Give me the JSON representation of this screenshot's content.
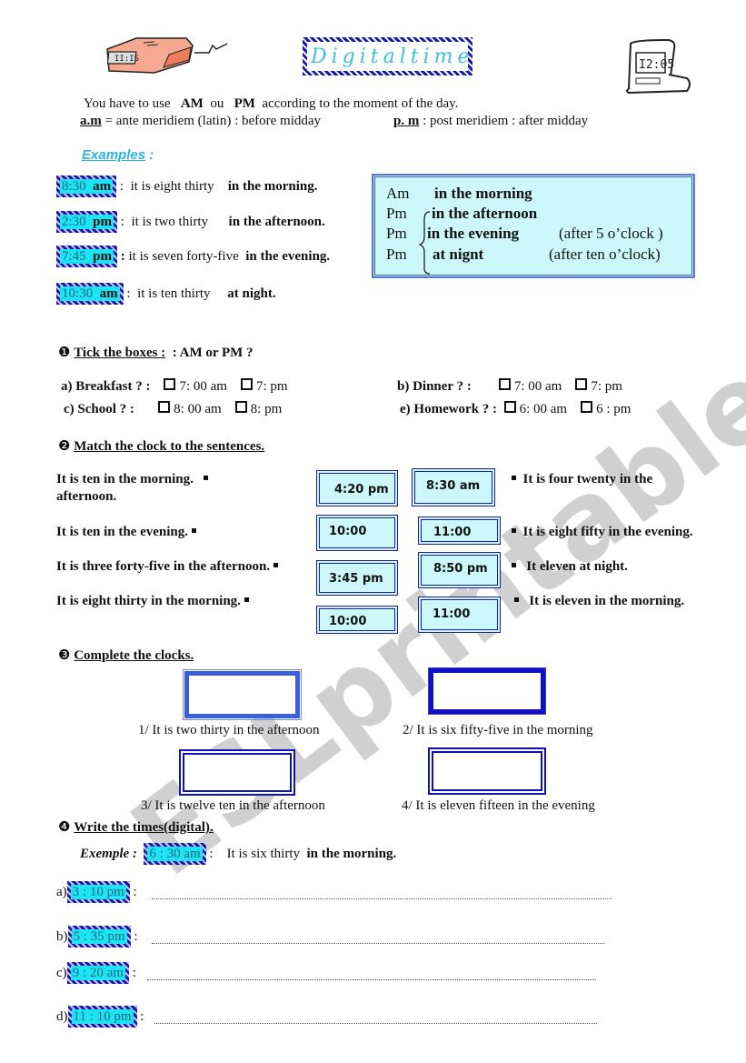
{
  "header": {
    "title": [
      "Digital",
      "time"
    ],
    "intro_line1": {
      "pre": "You have to use",
      "am": "AM",
      "ou": "ou",
      "pm": "PM",
      "post": "according to the moment of the day."
    },
    "intro_line2": {
      "am_label": "a.m",
      "am_def": "= ante meridiem (latin)  : before midday",
      "pm_label": "p. m",
      "pm_def": ":  post  meridiem : after midday"
    },
    "left_illustration": "alarm-clock-icon",
    "right_illustration": "digital-desk-clock-icon"
  },
  "examples": {
    "heading": "Examples",
    "colon": ":",
    "items": [
      {
        "time": "8:30",
        "ampm": "am",
        "sep": ":",
        "text": "it is eight thirty",
        "bold": "in the morning."
      },
      {
        "time": "2:30",
        "ampm": "pm",
        "sep": ":",
        "text": "it is two thirty",
        "bold": "in the afternoon."
      },
      {
        "time": "7:45",
        "ampm": "pm",
        "sep": ":",
        "text": "it is seven forty-five",
        "bold": "in the evening."
      },
      {
        "time": "10:30",
        "ampm": "am",
        "sep": ":",
        "text": "it is ten thirty",
        "bold": "at  night."
      }
    ],
    "legend": [
      {
        "key": "Am",
        "value": "in the morning",
        "note": ""
      },
      {
        "key": "Pm",
        "value": "in the afternoon",
        "note": ""
      },
      {
        "key": "Pm",
        "value": "in the  evening",
        "note": "(after 5 o’clock )"
      },
      {
        "key": "Pm",
        "value": "at nignt",
        "note": "(after ten o’clock)"
      }
    ]
  },
  "section1": {
    "bullet": "❶",
    "title": "Tick the boxes :",
    "question": ":   AM  or  PM ?",
    "items": [
      {
        "label": "a)   Breakfast ?   :",
        "opt1": "7: 00  am",
        "opt2": "7: pm"
      },
      {
        "label": "b) Dinner ?   :",
        "opt1": "7: 00  am",
        "opt2": "7: pm"
      },
      {
        "label": "c)  School ?        :",
        "opt1": "8: 00  am",
        "opt2": "8: pm"
      },
      {
        "label": "e) Homework ? :",
        "opt1": "6: 00  am",
        "opt2": "6 : pm"
      }
    ]
  },
  "section2": {
    "bullet": "❷",
    "title": "Match the clock to the sentences.",
    "left_sentences": [
      "It is ten in the morning.",
      "afternoon.",
      "It is ten in the evening.",
      "It is  three forty-five in the afternoon.",
      "It is eight thirty in the morning."
    ],
    "clocks_col1": [
      "4:20 pm",
      "10:00",
      "3:45 pm",
      "10:00"
    ],
    "clocks_col2": [
      "8:30 am",
      "11:00",
      "8:50 pm",
      "11:00"
    ],
    "right_sentences": [
      "It  is four twenty in the",
      "It is eight fifty  in the evening.",
      "It  eleven  at night.",
      "It is eleven  in the morning."
    ]
  },
  "section3": {
    "bullet": "❸",
    "title": "Complete  the clocks.",
    "items": [
      "1/ It is two thirty in the afternoon",
      "2/ It is six fifty-five in the morning",
      "3/ It is twelve ten in the afternoon",
      "4/ It is eleven fifteen in the evening"
    ]
  },
  "section4": {
    "bullet": "❹",
    "title": "Write the times(digital).",
    "example": {
      "label": "Exemple :",
      "time": "6 : 30  am",
      "sep": ":",
      "text": "It is six  thirty",
      "bold": "in the morning."
    },
    "items": [
      {
        "letter": "a)",
        "time": "3 : 10 pm",
        "sep": ":"
      },
      {
        "letter": "b)",
        "time": "5 : 35 pm",
        "sep": ":"
      },
      {
        "letter": "c)",
        "time": "9 : 20 am",
        "sep": ":"
      },
      {
        "letter": "d)",
        "time": "11 : 10 pm",
        "sep": ":"
      }
    ]
  },
  "watermark": "ESLprintables.com",
  "colors": {
    "tag_fill": "#1ce4f4",
    "tag_border": "#1a1aa8",
    "box_fill": "#ccf8fc",
    "title_text": "#3cc0d8",
    "examples_heading": "#2ab4e0"
  }
}
